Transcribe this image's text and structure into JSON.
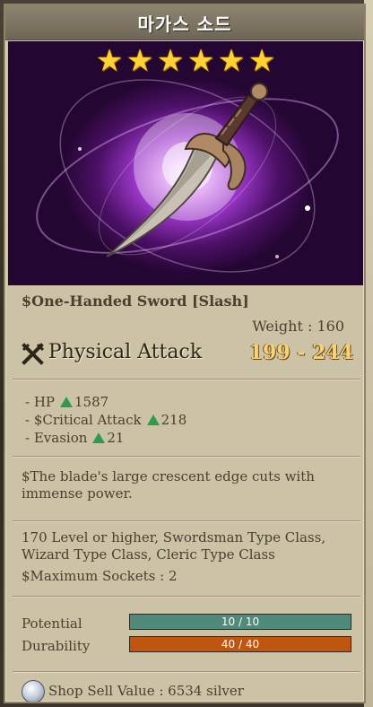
{
  "item": {
    "name": "마가스 소드",
    "stars": 6,
    "type_line": "$One-Handed Sword [Slash]",
    "weight": "Weight : 160",
    "attack_label": "Physical Attack",
    "attack_value": "199 - 244",
    "stats": [
      {
        "label": "- HP",
        "value": "1587"
      },
      {
        "label": "- $Critical Attack",
        "value": "218"
      },
      {
        "label": "- Evasion",
        "value": "21"
      }
    ],
    "description": "$The blade's large crescent edge cuts with immense power.",
    "requirements": "170 Level or higher, Swordsman Type Class, Wizard Type Class, Cleric Type Class",
    "sockets": "$Maximum Sockets : 2",
    "potential": {
      "label": "Potential",
      "text": "10 / 10",
      "fraction": 1.0,
      "color": "#4f8a7a"
    },
    "durability": {
      "label": "Durability",
      "text": "40 / 40",
      "fraction": 1.0,
      "color": "#c0550f"
    },
    "sell_value": "Shop Sell Value : 6534 silver"
  },
  "icons": {
    "star": "star-icon",
    "attack": "crossed-swords-icon",
    "increase": "up-triangle-icon",
    "coin": "silver-coin-icon"
  },
  "colors": {
    "star": "#ffd234",
    "attack_value": "#f6d27a",
    "stat_up": "#2e9c4a"
  }
}
